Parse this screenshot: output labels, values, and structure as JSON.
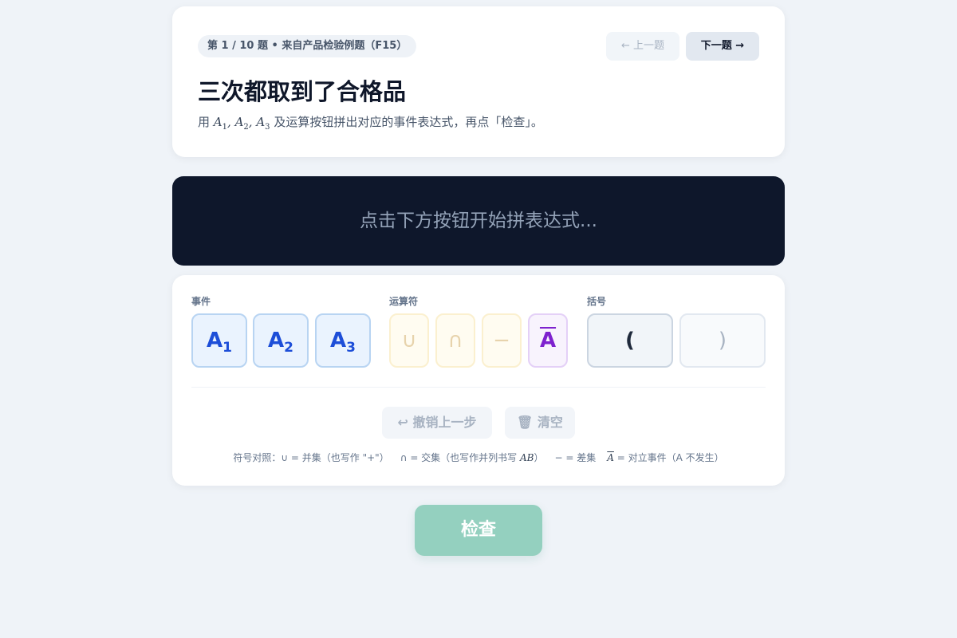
{
  "question": {
    "progress": "第 1 / 10 题 • 来自产品检验例题（F15）",
    "prev_label": "← 上一题",
    "next_label": "下一题 →",
    "title": "三次都取到了合格品",
    "desc_prefix": "用",
    "events_inline": [
      "A",
      "A",
      "A"
    ],
    "subscripts": [
      "1",
      "2",
      "3"
    ],
    "desc_suffix": "及运算按钮拼出对应的事件表达式，再点「检查」。"
  },
  "display": {
    "placeholder": "点击下方按钮开始拼表达式..."
  },
  "keypad": {
    "group_events": "事件",
    "group_ops": "运算符",
    "group_brackets": "括号",
    "events": [
      {
        "letter": "A",
        "sub": "1"
      },
      {
        "letter": "A",
        "sub": "2"
      },
      {
        "letter": "A",
        "sub": "3"
      }
    ],
    "ops": [
      "∪",
      "∩",
      "−",
      "A"
    ],
    "brackets": [
      "(",
      ")"
    ],
    "undo_label": "↩ 撤销上一步",
    "clear_label": "🗑 清空",
    "legend": {
      "prefix": "符号对照：",
      "union": "∪ = 并集（也写作 \"+\"）",
      "intersect_a": "∩ = 交集（也写作并列书写",
      "intersect_math": "AB",
      "intersect_b": "）",
      "diff": "− = 差集",
      "complement_math": "A",
      "complement_text": "= 对立事件（A 不发生）"
    }
  },
  "check_label": "检查",
  "colors": {
    "background": "#eff3f8",
    "display_bg": "#0e172b",
    "event_key": "#1d4ed8",
    "complement_key": "#7e22ce",
    "check_button": "#94d0bf"
  }
}
